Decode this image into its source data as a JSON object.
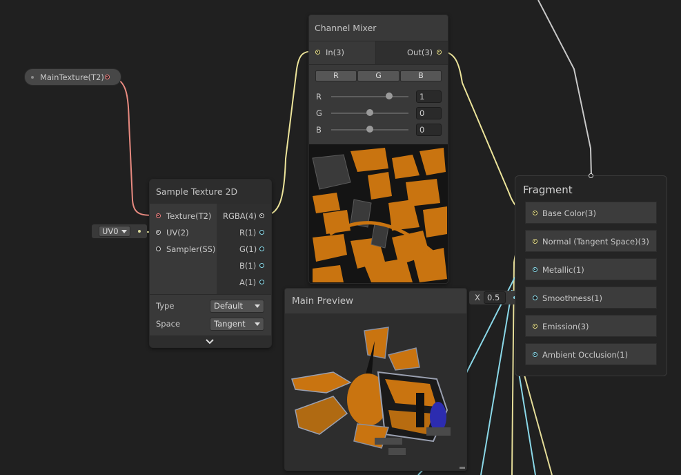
{
  "property_node": {
    "label": "MainTexture(T2)"
  },
  "sample_texture": {
    "title": "Sample Texture 2D",
    "inputs": [
      "Texture(T2)",
      "UV(2)",
      "Sampler(SS)"
    ],
    "outputs": [
      "RGBA(4)",
      "R(1)",
      "G(1)",
      "B(1)",
      "A(1)"
    ],
    "type_label": "Type",
    "type_value": "Default",
    "space_label": "Space",
    "space_value": "Tangent"
  },
  "uv_input": {
    "value": "UV0"
  },
  "channel_mixer": {
    "title": "Channel Mixer",
    "input": "In(3)",
    "output": "Out(3)",
    "buttons": [
      "R",
      "G",
      "B"
    ],
    "sliders": [
      {
        "label": "R",
        "value": "1",
        "level": 0.75
      },
      {
        "label": "G",
        "value": "0",
        "level": 0.5
      },
      {
        "label": "B",
        "value": "0",
        "level": 0.5
      }
    ]
  },
  "main_preview": {
    "title": "Main Preview"
  },
  "smoothness_input": {
    "axis": "X",
    "value": "0.5"
  },
  "fragment": {
    "title": "Fragment",
    "slots": [
      "Base Color(3)",
      "Normal (Tangent Space)(3)",
      "Metallic(1)",
      "Smoothness(1)",
      "Emission(3)",
      "Ambient Occlusion(1)"
    ]
  },
  "colors": {
    "canvas": "#202020",
    "node": "#393939",
    "header": "#2d2d2d",
    "vector3": "#e8e08a",
    "texture": "#f08080",
    "float": "#8adcec",
    "uv_wire": "#dcdc9a"
  }
}
